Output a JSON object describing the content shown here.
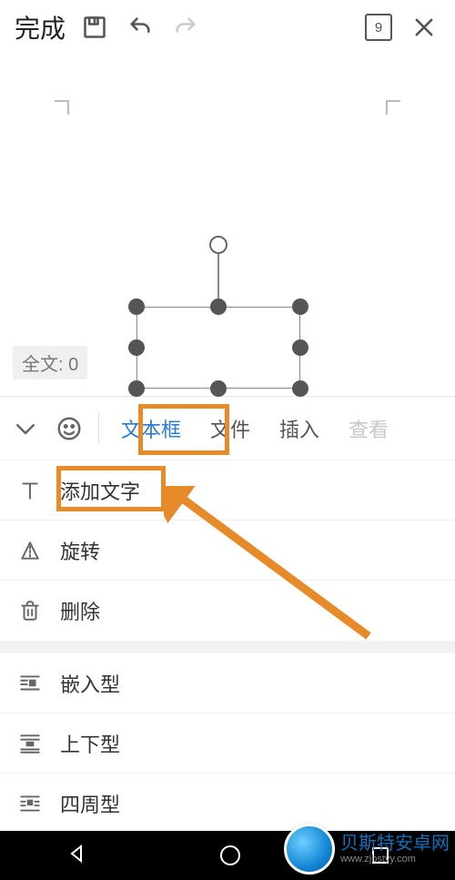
{
  "topbar": {
    "done_label": "完成",
    "page_count": "9"
  },
  "canvas": {
    "word_count_label": "全文: 0"
  },
  "tabs": {
    "items": [
      {
        "label": "文本框",
        "active": true
      },
      {
        "label": "文件",
        "active": false
      },
      {
        "label": "插入",
        "active": false
      },
      {
        "label": "查看",
        "active": false,
        "faded": true
      }
    ]
  },
  "menu": {
    "group1": [
      {
        "icon": "text-icon",
        "label": "添加文字"
      },
      {
        "icon": "rotate-icon",
        "label": "旋转"
      },
      {
        "icon": "trash-icon",
        "label": "删除"
      }
    ],
    "group2": [
      {
        "icon": "wrap-inline-icon",
        "label": "嵌入型"
      },
      {
        "icon": "wrap-topbottom-icon",
        "label": "上下型"
      },
      {
        "icon": "wrap-around-icon",
        "label": "四周型"
      }
    ]
  },
  "watermark": {
    "title": "贝斯特安卓网",
    "url": "www.zjbstyy.com"
  }
}
